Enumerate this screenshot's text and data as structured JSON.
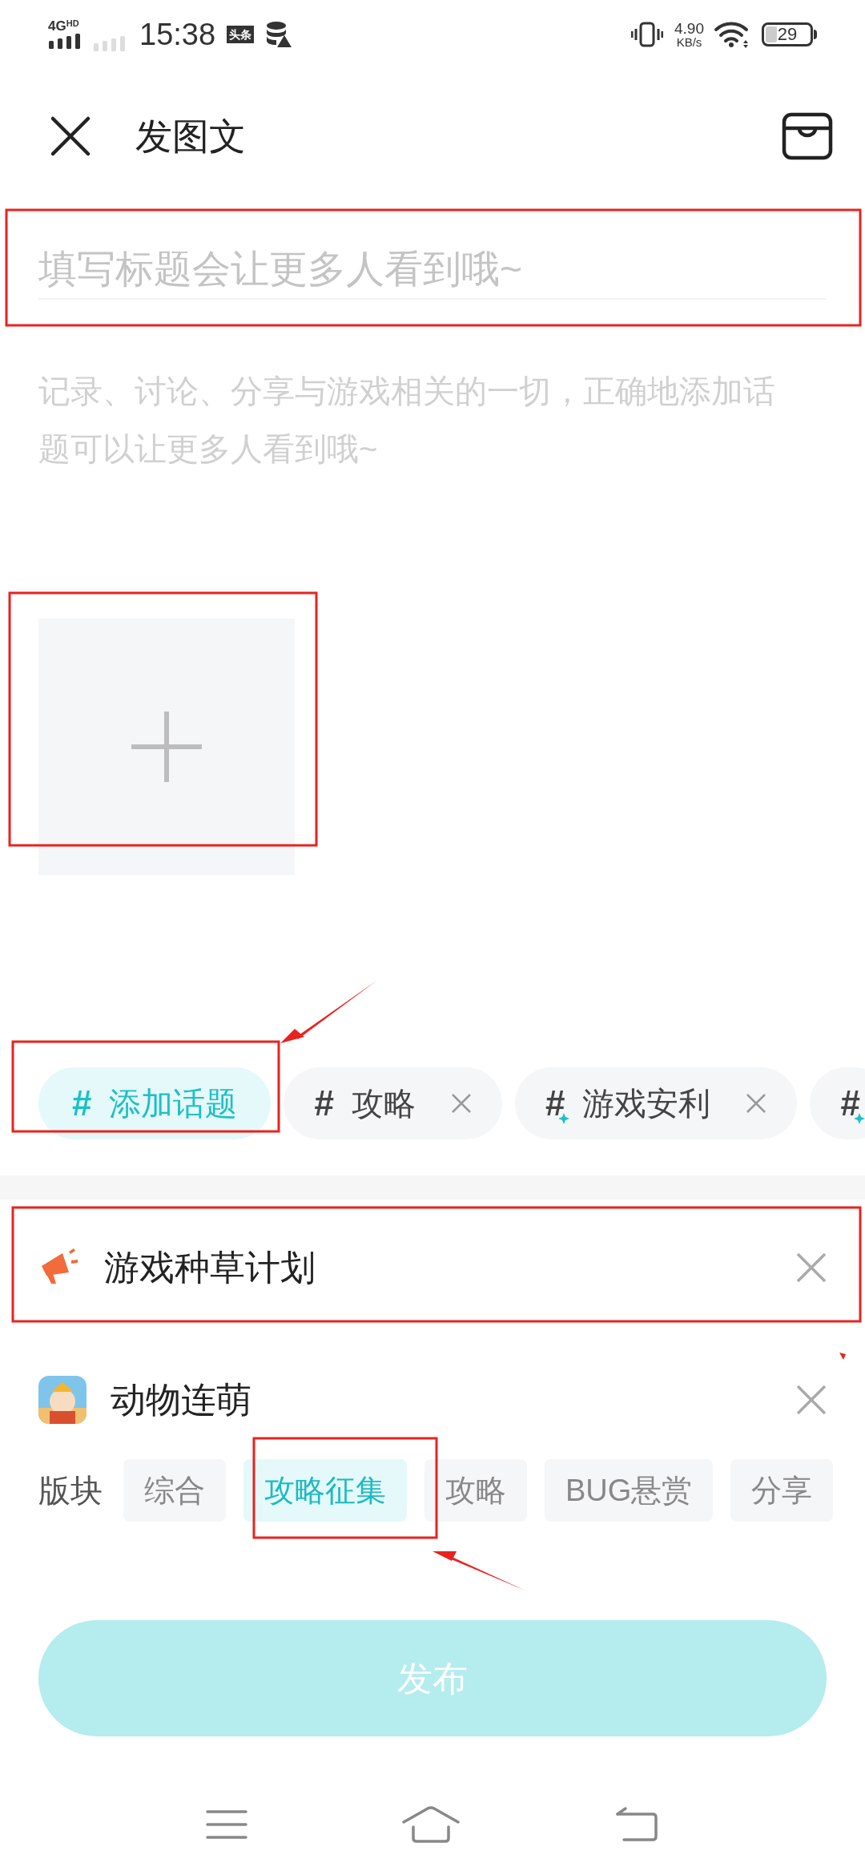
{
  "status_bar": {
    "network": "4G",
    "network_badge": "HD",
    "time": "15:38",
    "app_badge": "头条",
    "speed": "4.90",
    "speed_unit": "KB/s",
    "battery": "29"
  },
  "header": {
    "title": "发图文"
  },
  "title_field": {
    "placeholder": "填写标题会让更多人看到哦~"
  },
  "body_field": {
    "placeholder": "记录、讨论、分享与游戏相关的一切，正确地添加话题可以让更多人看到哦~"
  },
  "topics": [
    {
      "kind": "add",
      "hash": "#",
      "label": "添加话题"
    },
    {
      "kind": "tag",
      "hash": "#",
      "label": "攻略"
    },
    {
      "kind": "trending",
      "hash": "#",
      "label": "游戏安利"
    },
    {
      "kind": "trending",
      "hash": "#"
    }
  ],
  "activity": {
    "label": "游戏种草计划"
  },
  "game": {
    "name": "动物连萌"
  },
  "sections": {
    "label": "版块",
    "options": [
      {
        "label": "综合",
        "selected": false
      },
      {
        "label": "攻略征集",
        "selected": true
      },
      {
        "label": "攻略",
        "selected": false
      },
      {
        "label": "BUG悬赏",
        "selected": false
      },
      {
        "label": "分享",
        "selected": false
      }
    ]
  },
  "publish_button": {
    "label": "发布"
  }
}
